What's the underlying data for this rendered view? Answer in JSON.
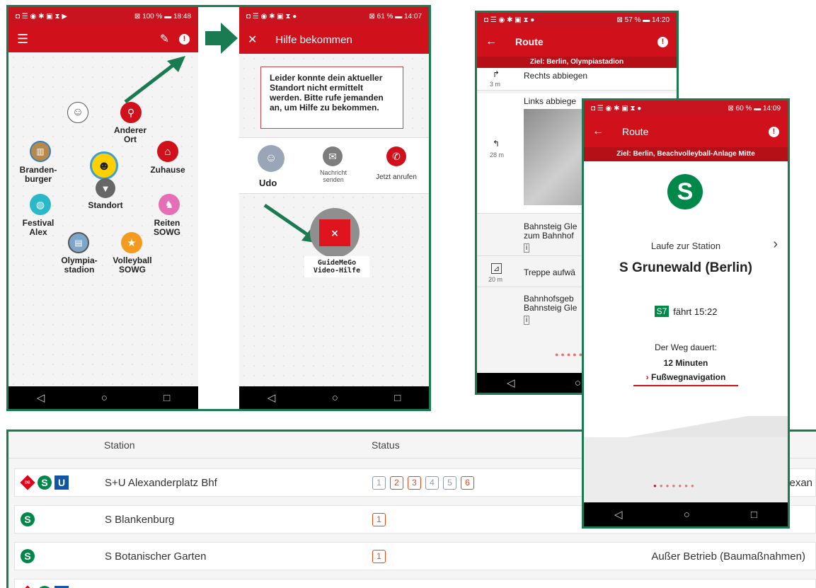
{
  "screen1": {
    "status_left": "◘ ☰ ◉ ✱ ▣ ⧗ ▶",
    "status_right": "⊠ 100 % ▬ 18:48",
    "places": [
      {
        "id": "anderer-ort",
        "label": "Anderer\nOrt"
      },
      {
        "id": "brandenburger",
        "label": "Branden-\nburger"
      },
      {
        "id": "zuhause",
        "label": "Zuhause"
      },
      {
        "id": "standort",
        "label": "Standort"
      },
      {
        "id": "festival",
        "label": "Festival\nAlex"
      },
      {
        "id": "reiten",
        "label": "Reiten\nSOWG"
      },
      {
        "id": "olympia",
        "label": "Olympia-\nstadion"
      },
      {
        "id": "volleyball",
        "label": "Volleyball\nSOWG"
      }
    ]
  },
  "screen2": {
    "status_left": "◘ ☰ ◉ ✱ ▣ ⧗ ●",
    "status_right": "⊠ 61 % ▬ 14:07",
    "title": "Hilfe bekommen",
    "message": "Leider konnte dein aktueller Standort nicht ermittelt werden. Bitte rufe jemanden an, um Hilfe zu bekommen.",
    "contact_name": "Udo",
    "message_button": "Nachricht senden",
    "call_button": "Jetzt anrufen",
    "video_help": "GuideMeGo\nVideo-Hilfe"
  },
  "screen3": {
    "status_left": "◘ ☰ ◉ ✱ ▣ ⧗ ●",
    "status_right": "⊠ 57 % ▬ 14:20",
    "title": "Route",
    "destination": "Ziel: Berlin, Olympiastadion",
    "steps": [
      {
        "distance": "3 m",
        "text": "Rechts abbiegen"
      },
      {
        "distance": "28 m",
        "text": "Links abbiege"
      },
      {
        "distance": "",
        "text": "Bahnsteig Gle\nzum Bahnhof"
      },
      {
        "distance": "20 m",
        "text": "Treppe aufwä"
      },
      {
        "distance": "",
        "text": "Bahnhofsgeb\nBahnsteig Gle"
      }
    ]
  },
  "screen4": {
    "status_left": "◘ ☰ ◉ ✱ ▣ ⧗ ●",
    "status_right": "⊠ 60 % ▬ 14:09",
    "title": "Route",
    "destination": "Ziel: Berlin, Beachvolleyball-Anlage Mitte",
    "walk_to": "Laufe zur Station",
    "station": "S Grunewald (Berlin)",
    "line": "S7",
    "departure": "fährt 15:22",
    "duration_label": "Der Weg dauert:",
    "duration": "12 Minuten",
    "nav_link": "Fußwegnavigation"
  },
  "table": {
    "headers": {
      "station": "Station",
      "status": "Status"
    },
    "rows": [
      {
        "station": "S+U Alexanderplatz Bhf",
        "chips": [
          "1",
          "2",
          "3",
          "4",
          "5",
          "6"
        ],
        "red": [
          false,
          true,
          true,
          false,
          false,
          true
        ],
        "text": "lexan"
      },
      {
        "station": "S Blankenburg",
        "chips": [
          "1"
        ],
        "red": [
          true
        ],
        "text": ""
      },
      {
        "station": "S Botanischer Garten",
        "chips": [
          "1"
        ],
        "red": [
          true
        ],
        "text": "Außer Betrieb (Baumaßnahmen)"
      }
    ]
  },
  "colors": {
    "red": "#d0111b",
    "green_frame": "#1a7a52",
    "sbahn": "#00874a",
    "ubahn": "#1156a6"
  }
}
